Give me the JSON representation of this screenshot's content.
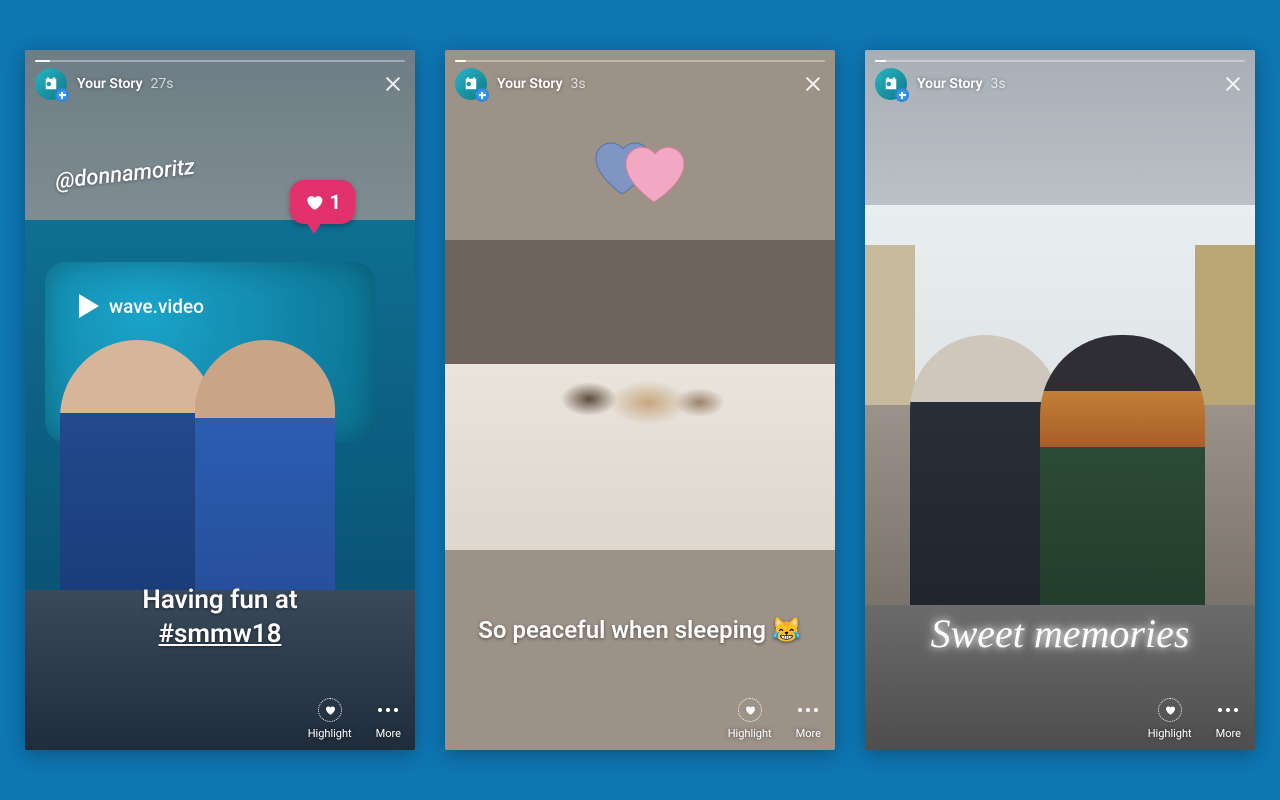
{
  "background_color": "#0e76b3",
  "stories": [
    {
      "title": "Your Story",
      "time": "27s",
      "progress_pct": 4,
      "mention": "@donnamoritz",
      "like_count": "1",
      "booth_brand": "wave.video",
      "caption_line1": "Having fun at",
      "caption_hashtag": "#smmw18",
      "sticker": "like-bubble",
      "actions": {
        "highlight": "Highlight",
        "more": "More"
      }
    },
    {
      "title": "Your Story",
      "time": "3s",
      "progress_pct": 3,
      "caption": "So peaceful when sleeping 😹",
      "sticker": "two-hearts",
      "actions": {
        "highlight": "Highlight",
        "more": "More"
      }
    },
    {
      "title": "Your Story",
      "time": "3s",
      "progress_pct": 3,
      "caption": "Sweet memories",
      "caption_style": "neon-script",
      "actions": {
        "highlight": "Highlight",
        "more": "More"
      }
    }
  ]
}
